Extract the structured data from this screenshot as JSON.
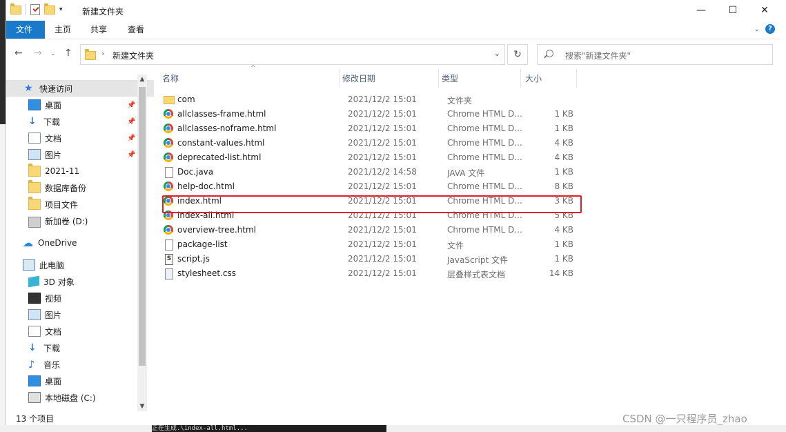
{
  "window": {
    "title": "新建文件夹"
  },
  "ribbon": {
    "tabs": [
      "文件",
      "主页",
      "共享",
      "查看"
    ]
  },
  "address": {
    "path": "新建文件夹",
    "search_placeholder": "搜索\"新建文件夹\""
  },
  "nav": {
    "items": [
      {
        "label": "快速访问",
        "icon": "star-icon"
      },
      {
        "label": "桌面",
        "icon": "desktop-icon"
      },
      {
        "label": "下载",
        "icon": "download-icon"
      },
      {
        "label": "文档",
        "icon": "document-icon"
      },
      {
        "label": "图片",
        "icon": "pictures-icon"
      },
      {
        "label": "2021-11",
        "icon": "folder-icon"
      },
      {
        "label": "数据库备份",
        "icon": "folder-icon"
      },
      {
        "label": "项目文件",
        "icon": "folder-icon"
      },
      {
        "label": "新加卷 (D:)",
        "icon": "drive-icon"
      },
      {
        "label": "OneDrive",
        "icon": "cloud-icon"
      },
      {
        "label": "此电脑",
        "icon": "computer-icon"
      },
      {
        "label": "3D 对象",
        "icon": "3d-objects-icon"
      },
      {
        "label": "视频",
        "icon": "video-icon"
      },
      {
        "label": "图片",
        "icon": "pictures-icon"
      },
      {
        "label": "文档",
        "icon": "document-icon"
      },
      {
        "label": "下载",
        "icon": "download-icon"
      },
      {
        "label": "音乐",
        "icon": "music-icon"
      },
      {
        "label": "桌面",
        "icon": "desktop-icon"
      },
      {
        "label": "本地磁盘 (C:)",
        "icon": "local-disk-icon"
      }
    ]
  },
  "columns": {
    "name": "名称",
    "date": "修改日期",
    "type": "类型",
    "size": "大小"
  },
  "files": [
    {
      "name": "com",
      "date": "2021/12/2 15:01",
      "type": "文件夹",
      "size": "",
      "icon": "folder"
    },
    {
      "name": "allclasses-frame.html",
      "date": "2021/12/2 15:01",
      "type": "Chrome HTML D...",
      "size": "1 KB",
      "icon": "chrome"
    },
    {
      "name": "allclasses-noframe.html",
      "date": "2021/12/2 15:01",
      "type": "Chrome HTML D...",
      "size": "1 KB",
      "icon": "chrome"
    },
    {
      "name": "constant-values.html",
      "date": "2021/12/2 15:01",
      "type": "Chrome HTML D...",
      "size": "4 KB",
      "icon": "chrome"
    },
    {
      "name": "deprecated-list.html",
      "date": "2021/12/2 15:01",
      "type": "Chrome HTML D...",
      "size": "4 KB",
      "icon": "chrome"
    },
    {
      "name": "Doc.java",
      "date": "2021/12/2 14:58",
      "type": "JAVA 文件",
      "size": "1 KB",
      "icon": "blank"
    },
    {
      "name": "help-doc.html",
      "date": "2021/12/2 15:01",
      "type": "Chrome HTML D...",
      "size": "8 KB",
      "icon": "chrome"
    },
    {
      "name": "index.html",
      "date": "2021/12/2 15:01",
      "type": "Chrome HTML D...",
      "size": "3 KB",
      "icon": "chrome"
    },
    {
      "name": "index-all.html",
      "date": "2021/12/2 15:01",
      "type": "Chrome HTML D...",
      "size": "5 KB",
      "icon": "chrome"
    },
    {
      "name": "overview-tree.html",
      "date": "2021/12/2 15:01",
      "type": "Chrome HTML D...",
      "size": "4 KB",
      "icon": "chrome"
    },
    {
      "name": "package-list",
      "date": "2021/12/2 15:01",
      "type": "文件",
      "size": "1 KB",
      "icon": "blank"
    },
    {
      "name": "script.js",
      "date": "2021/12/2 15:01",
      "type": "JavaScript 文件",
      "size": "1 KB",
      "icon": "js"
    },
    {
      "name": "stylesheet.css",
      "date": "2021/12/2 15:01",
      "type": "层叠样式表文档",
      "size": "14 KB",
      "icon": "css"
    }
  ],
  "status": {
    "count": "13 个项目"
  },
  "watermark": "CSDN @一只程序员_zhao",
  "terminal_text": "正在生成.\\index-all.html...",
  "colors": {
    "accent": "#1979ca",
    "highlight": "#e02020"
  }
}
